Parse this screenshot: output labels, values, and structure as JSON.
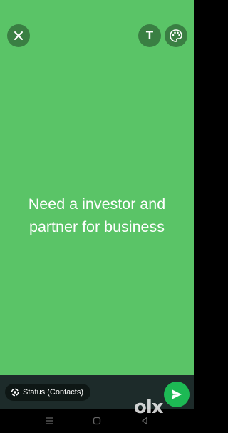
{
  "status": {
    "text": "Need a investor and partner for business",
    "background_color": "#5ac467"
  },
  "top_bar": {
    "close_icon": "close-icon",
    "text_tool_label": "T",
    "palette_icon": "palette-icon"
  },
  "bottom_bar": {
    "audience_label": "Status (Contacts)",
    "audience_icon": "status-ring-icon",
    "send_icon": "send-icon"
  },
  "nav": {
    "items": [
      "menu-icon",
      "home-icon",
      "back-icon"
    ]
  },
  "watermark": "olx"
}
